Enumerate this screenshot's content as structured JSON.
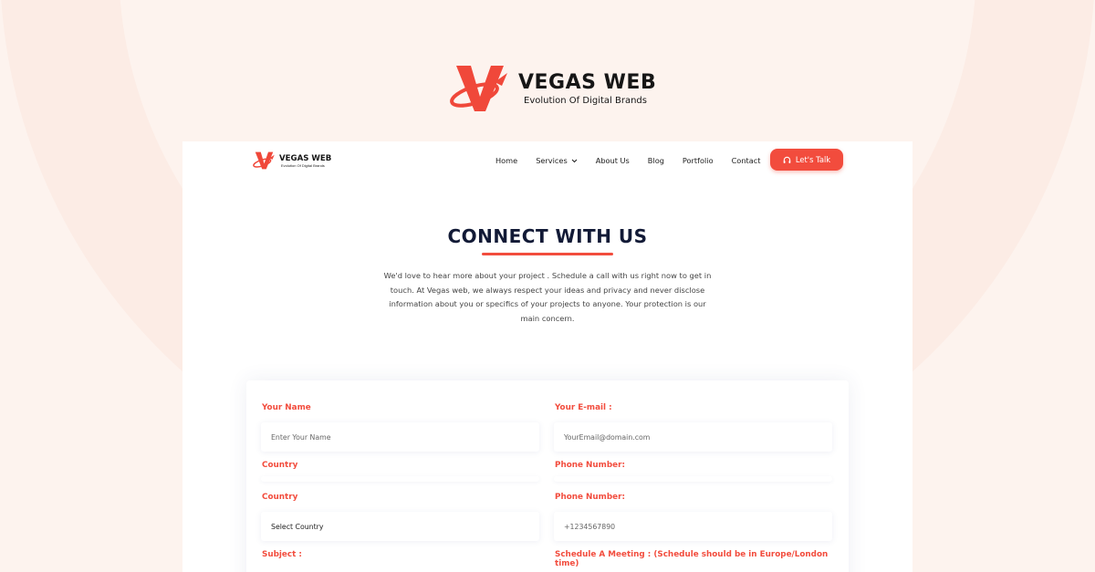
{
  "brand": {
    "name": "VEGAS WEB",
    "tagline": "Evolution Of Digital Brands",
    "accent_color": "#f24c3d",
    "heading_color": "#121a36"
  },
  "nav": {
    "logo_name": "VEGAS WEB",
    "logo_tagline": "Evolution Of Digital Brands",
    "links": [
      "Home",
      "Services",
      "About Us",
      "Blog",
      "Portfolio",
      "Contact"
    ],
    "services_icon": "chevron-down-icon",
    "cta_label": "Let's Talk",
    "cta_icon": "headphones-icon"
  },
  "page": {
    "title": "CONNECT WITH US",
    "intro": "We'd love to hear more about your project . Schedule a call with us right now to get in touch. At Vegas web, we always respect your ideas and privacy and never disclose information about you or specifics of your projects to anyone. Your protection is our main concern."
  },
  "form": {
    "name_label": "Your Name",
    "name_placeholder": "Enter Your Name",
    "email_label": "Your E-mail :",
    "email_placeholder": "YourEmail@domain.com",
    "country_label_1": "Country",
    "phone_label_1": "Phone Number:",
    "country_label_2": "Country",
    "country_value": "Select Country",
    "phone_label_2": "Phone Number:",
    "phone_placeholder": "+1234567890",
    "subject_label": "Subject :",
    "schedule_label": "Schedule A Meeting : (Schedule should be in Europe/London time)"
  }
}
